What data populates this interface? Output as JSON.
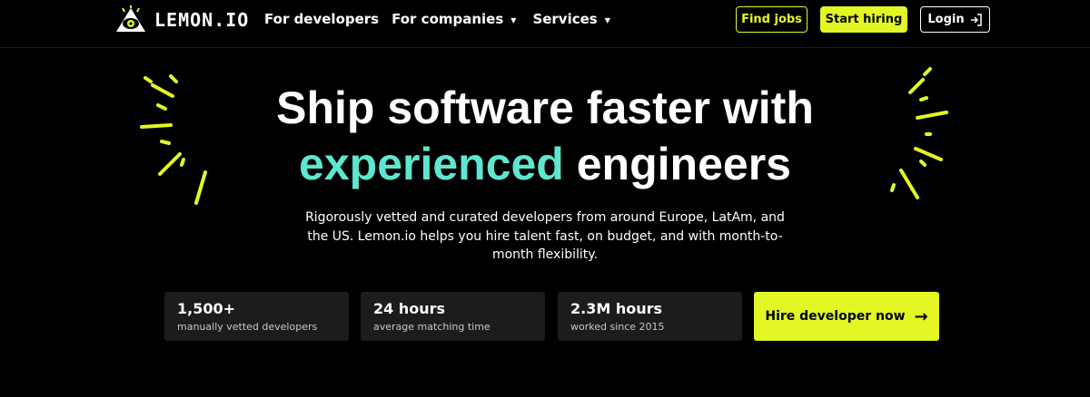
{
  "header": {
    "logo_text": "LEMON.IO",
    "nav": [
      {
        "label": "For developers",
        "has_caret": false
      },
      {
        "label": "For companies",
        "has_caret": true
      },
      {
        "label": "Services",
        "has_caret": true
      }
    ],
    "find_jobs": "Find jobs",
    "start_hiring": "Start hiring",
    "login": "Login"
  },
  "hero": {
    "title_line1": "Ship software faster with",
    "title_accent": "experienced",
    "title_rest": " engineers",
    "subtitle": "Rigorously vetted and curated developers from around Europe, LatAm, and the US. Lemon.io helps you hire talent fast, on budget, and with month-to-month flexibility."
  },
  "stats": [
    {
      "value": "1,500+",
      "label": "manually vetted developers"
    },
    {
      "value": "24 hours",
      "label": "average matching time"
    },
    {
      "value": "2.3M hours",
      "label": "worked since 2015"
    }
  ],
  "cta": {
    "label": "Hire developer now",
    "arrow": "→"
  },
  "colors": {
    "accent_lime": "#e3f724",
    "accent_teal": "#5ee6d0",
    "background": "#000000",
    "card": "#1c1c1c"
  },
  "icons": {
    "logo": "lemon-eye-logo-icon",
    "login": "login-arrow-icon",
    "caret": "caret-down-icon",
    "decor": "sparkle-burst-icon"
  }
}
